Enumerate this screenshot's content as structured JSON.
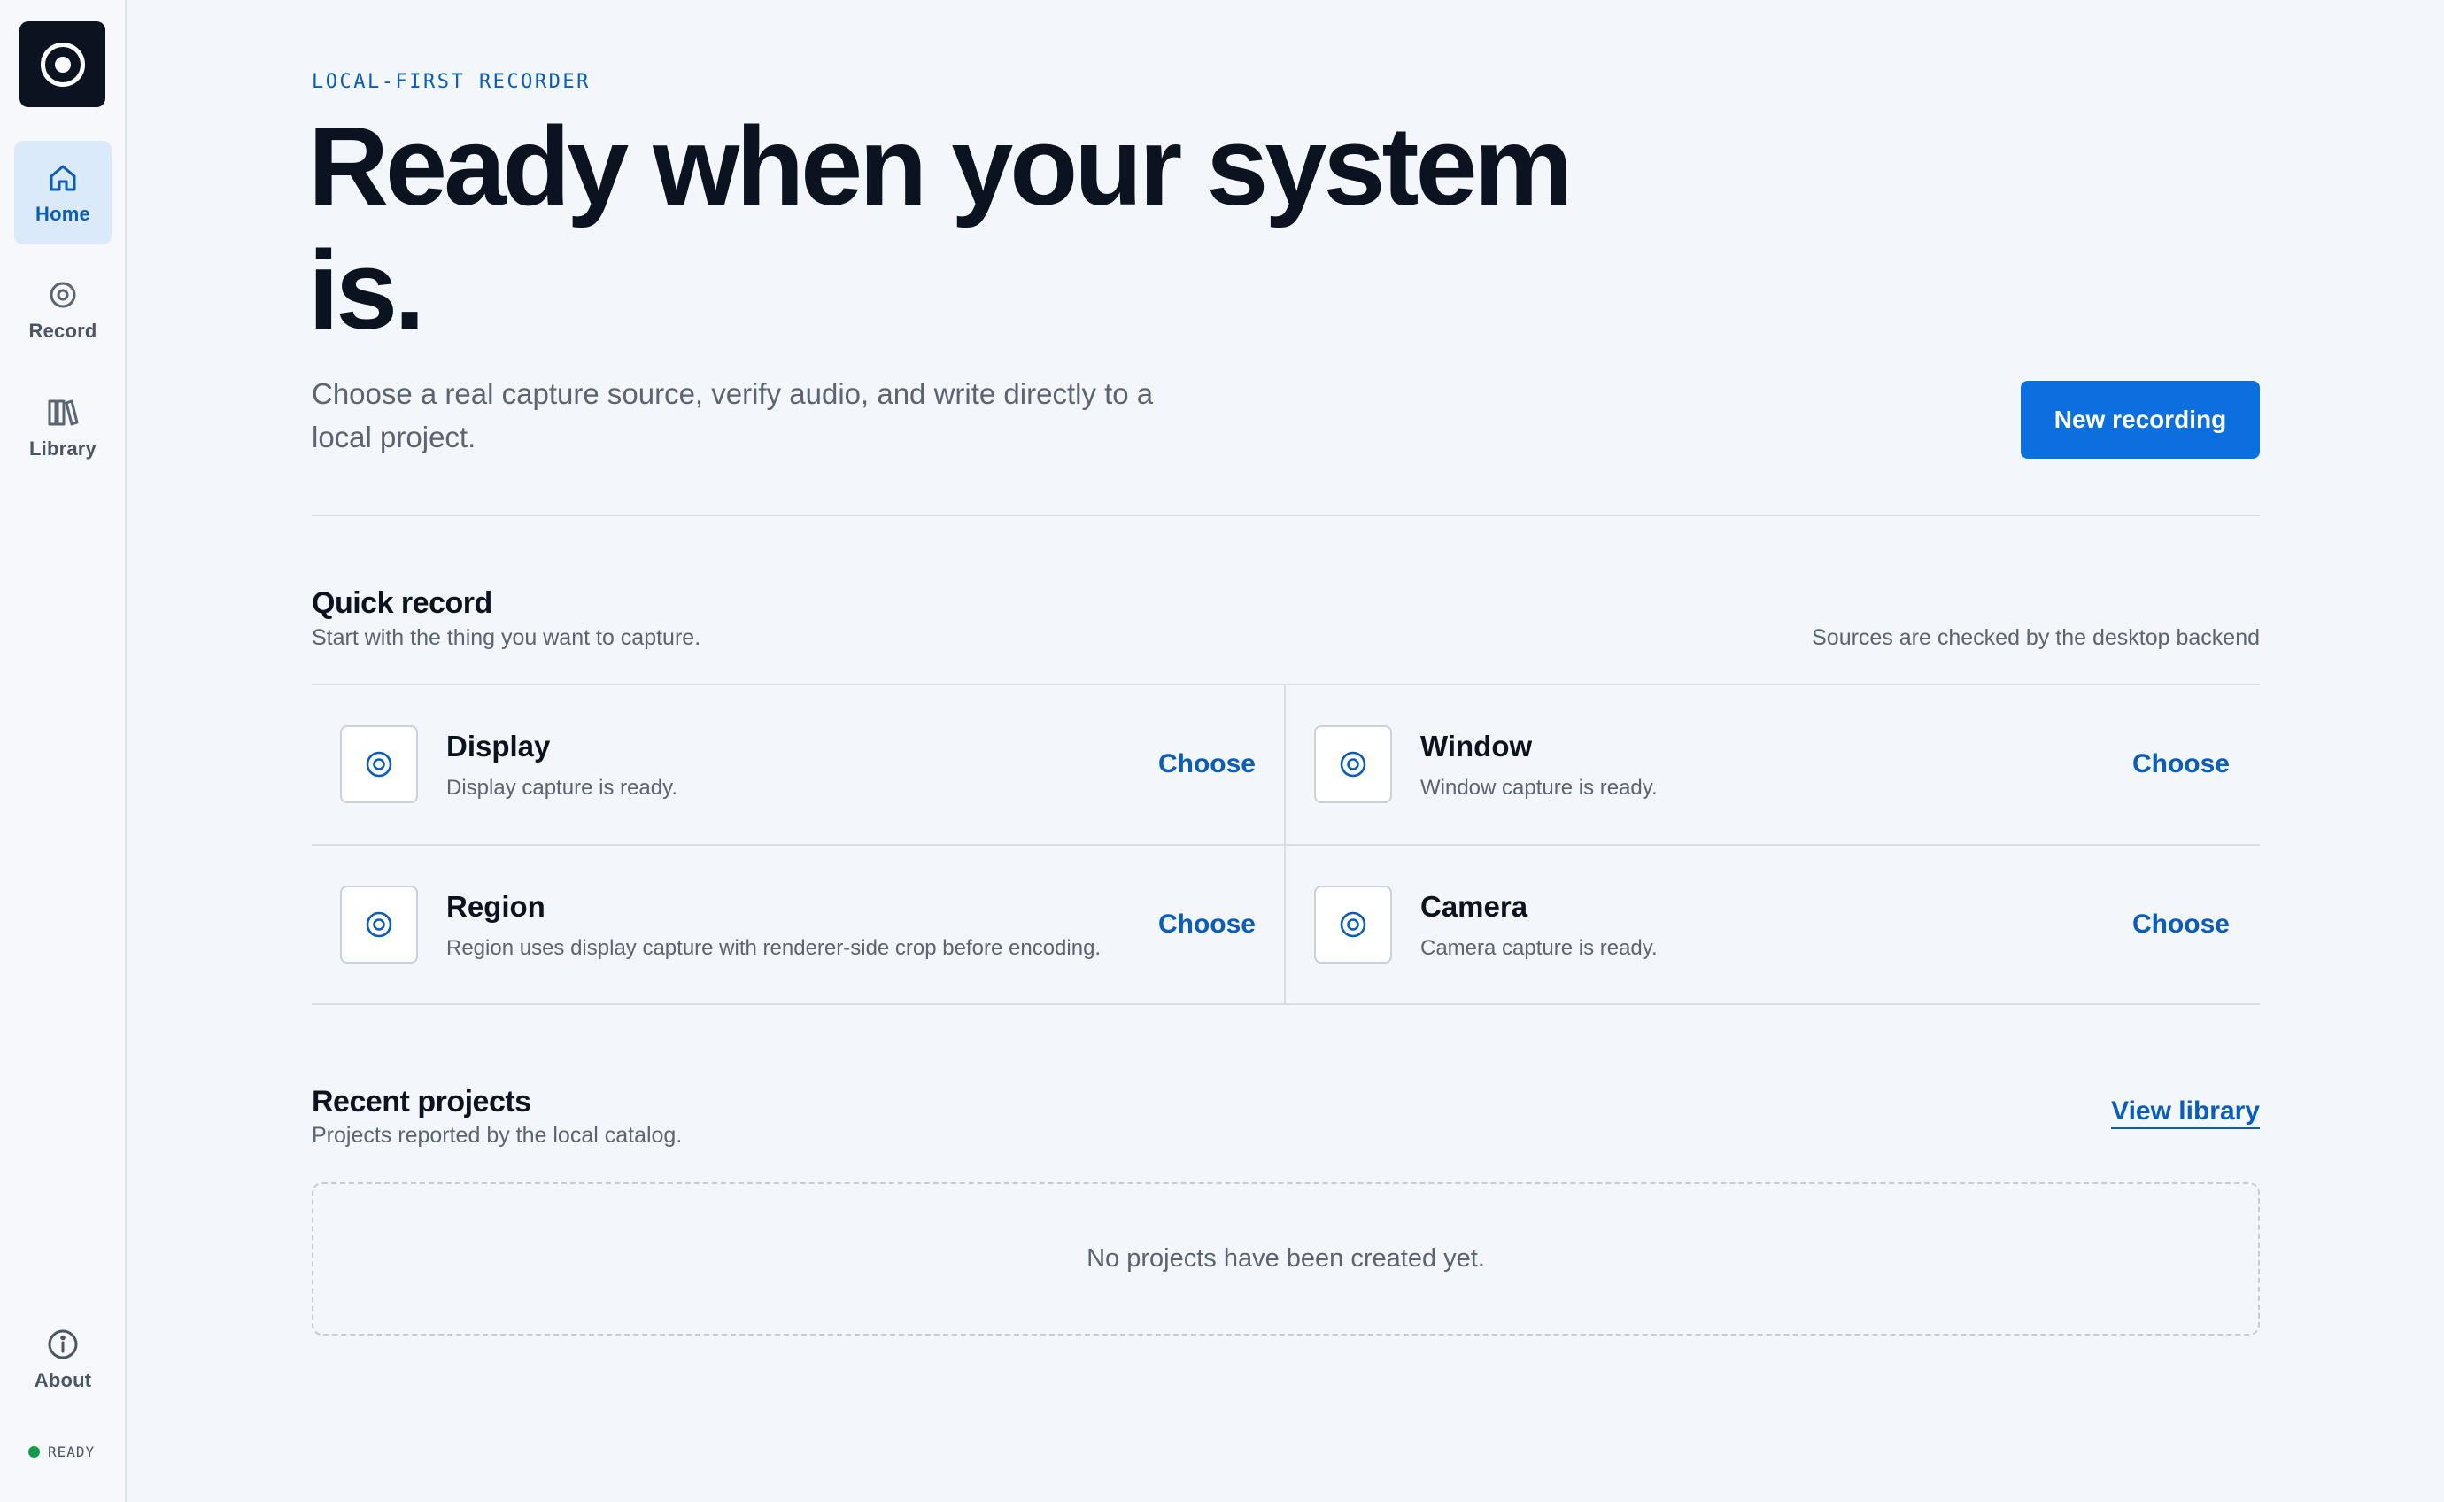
{
  "sidebar": {
    "logo_icon": "record-icon",
    "items": [
      {
        "label": "Home",
        "icon": "home-icon",
        "active": true
      },
      {
        "label": "Record",
        "icon": "record-icon",
        "active": false
      },
      {
        "label": "Library",
        "icon": "books-icon",
        "active": false
      }
    ],
    "about": {
      "label": "About",
      "icon": "info-icon"
    },
    "status": {
      "label": "READY",
      "color": "#119a4a"
    }
  },
  "hero": {
    "eyebrow": "LOCAL-FIRST RECORDER",
    "title": "Ready when your system is.",
    "subtitle": "Choose a real capture source, verify audio, and write directly to a local project.",
    "cta_label": "New recording"
  },
  "quick_record": {
    "title": "Quick record",
    "subtitle": "Start with the thing you want to capture.",
    "note": "Sources are checked by the desktop backend",
    "sources": [
      {
        "name": "Display",
        "desc": "Display capture is ready.",
        "action": "Choose"
      },
      {
        "name": "Window",
        "desc": "Window capture is ready.",
        "action": "Choose"
      },
      {
        "name": "Region",
        "desc": "Region uses display capture with renderer-side crop before encoding.",
        "action": "Choose"
      },
      {
        "name": "Camera",
        "desc": "Camera capture is ready.",
        "action": "Choose"
      }
    ]
  },
  "recent": {
    "title": "Recent projects",
    "subtitle": "Projects reported by the local catalog.",
    "link_label": "View library",
    "empty_text": "No projects have been created yet."
  },
  "colors": {
    "accent": "#0a5db8",
    "cta": "#0b6fe0",
    "ink": "#0b1320",
    "background": "#f3f6fa"
  }
}
